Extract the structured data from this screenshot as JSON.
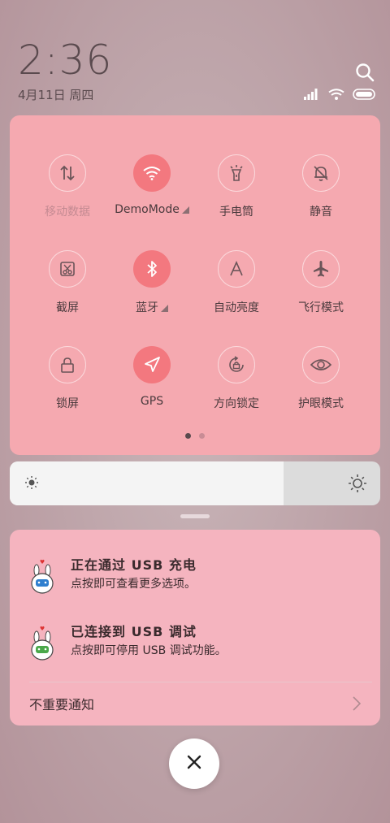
{
  "status": {
    "time": "2:36",
    "date": "4月11日 周四"
  },
  "quick_settings": {
    "tiles": [
      {
        "label": "移动数据",
        "icon": "mobile-data-icon",
        "active": false,
        "dim": true
      },
      {
        "label": "DemoMode",
        "icon": "wifi-icon",
        "active": true,
        "dim": false,
        "expand": true
      },
      {
        "label": "手电筒",
        "icon": "flashlight-icon",
        "active": false,
        "dim": false
      },
      {
        "label": "静音",
        "icon": "mute-bell-icon",
        "active": false,
        "dim": false
      },
      {
        "label": "截屏",
        "icon": "screenshot-icon",
        "active": false,
        "dim": false
      },
      {
        "label": "蓝牙",
        "icon": "bluetooth-icon",
        "active": true,
        "dim": false,
        "expand": true
      },
      {
        "label": "自动亮度",
        "icon": "auto-brightness-icon",
        "active": false,
        "dim": false
      },
      {
        "label": "飞行模式",
        "icon": "airplane-icon",
        "active": false,
        "dim": false
      },
      {
        "label": "锁屏",
        "icon": "lock-icon",
        "active": false,
        "dim": false
      },
      {
        "label": "GPS",
        "icon": "location-icon",
        "active": true,
        "dim": false
      },
      {
        "label": "方向锁定",
        "icon": "rotation-lock-icon",
        "active": false,
        "dim": false
      },
      {
        "label": "护眼模式",
        "icon": "eye-icon",
        "active": false,
        "dim": false
      }
    ],
    "page_count": 2,
    "current_page": 1
  },
  "brightness": {
    "level": 0.74
  },
  "notifications": [
    {
      "title": "正在通过 USB 充电",
      "body": "点按即可查看更多选项。",
      "icon": "app-mascot-icon"
    },
    {
      "title": "已连接到 USB 调试",
      "body": "点按即可停用 USB 调试功能。",
      "icon": "app-mascot-icon"
    }
  ],
  "unimportant_label": "不重要通知",
  "colors": {
    "panel": "#f5a9b0",
    "active_tile": "#f3787f",
    "notif_panel": "#f5b4bf"
  }
}
